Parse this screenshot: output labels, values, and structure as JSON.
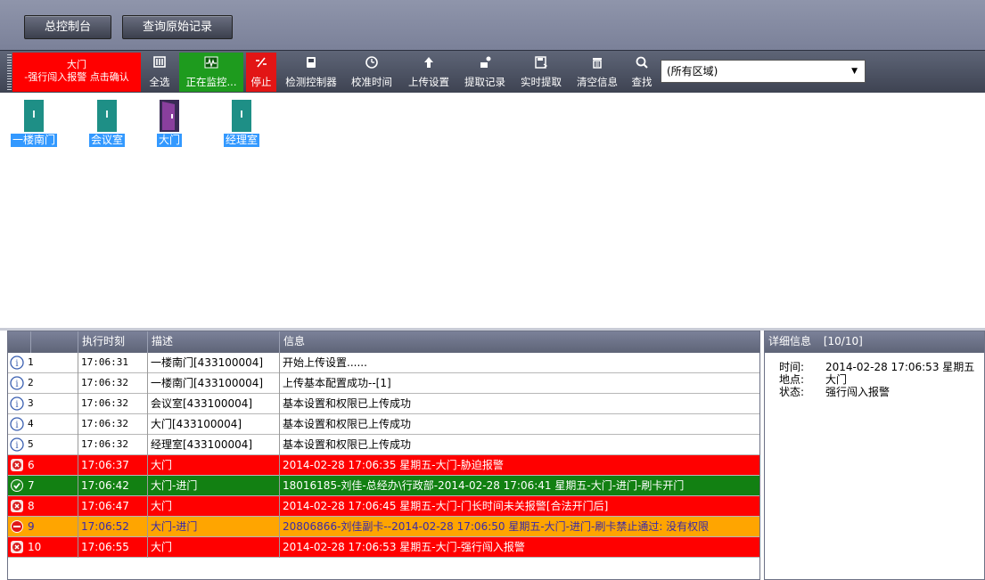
{
  "tabs": [
    "总控制台",
    "查询原始记录"
  ],
  "alarm_banner": {
    "line1": "大门",
    "line2": "-强行闯入报警 点击确认",
    "color": "#ff0000"
  },
  "toolbar": [
    {
      "id": "select-all",
      "icon": "select-all-icon",
      "label": "全选",
      "style": "normal"
    },
    {
      "id": "monitoring",
      "icon": "monitor-wave-icon",
      "label": "正在监控...",
      "style": "green"
    },
    {
      "id": "stop",
      "icon": "stop-icon",
      "label": "停止",
      "style": "red"
    },
    {
      "id": "check-controller",
      "icon": "controller-icon",
      "label": "检测控制器",
      "style": "normal"
    },
    {
      "id": "sync-time",
      "icon": "clock-icon",
      "label": "校准时间",
      "style": "normal"
    },
    {
      "id": "upload-settings",
      "icon": "upload-arrow-icon",
      "label": "上传设置",
      "style": "normal"
    },
    {
      "id": "fetch-records",
      "icon": "fetch-icon",
      "label": "提取记录",
      "style": "normal"
    },
    {
      "id": "realtime-fetch",
      "icon": "realtime-save-icon",
      "label": "实时提取",
      "style": "normal"
    },
    {
      "id": "clear-info",
      "icon": "trash-icon",
      "label": "清空信息",
      "style": "normal"
    },
    {
      "id": "search",
      "icon": "search-icon",
      "label": "查找",
      "style": "normal"
    }
  ],
  "area_select": {
    "value": "(所有区域)"
  },
  "doors": [
    {
      "label": "一楼南门",
      "state": "closed"
    },
    {
      "label": "会议室",
      "state": "closed"
    },
    {
      "label": "大门",
      "state": "open"
    },
    {
      "label": "经理室",
      "state": "closed"
    }
  ],
  "log": {
    "columns": [
      "",
      "执行时刻",
      "描述",
      "信息"
    ],
    "rows": [
      {
        "type": "info",
        "no": "1",
        "time": "17:06:31",
        "desc": "一楼南门[433100004]",
        "msg": "开始上传设置......"
      },
      {
        "type": "info",
        "no": "2",
        "time": "17:06:32",
        "desc": "一楼南门[433100004]",
        "msg": "上传基本配置成功--[1]"
      },
      {
        "type": "info",
        "no": "3",
        "time": "17:06:32",
        "desc": "会议室[433100004]",
        "msg": "基本设置和权限已上传成功"
      },
      {
        "type": "info",
        "no": "4",
        "time": "17:06:32",
        "desc": "大门[433100004]",
        "msg": "基本设置和权限已上传成功"
      },
      {
        "type": "info",
        "no": "5",
        "time": "17:06:32",
        "desc": "经理室[433100004]",
        "msg": "基本设置和权限已上传成功"
      },
      {
        "type": "alarm",
        "no": "6",
        "time": "17:06:37",
        "desc": "大门",
        "msg": "2014-02-28 17:06:35 星期五-大门-胁迫报警"
      },
      {
        "type": "ok",
        "no": "7",
        "time": "17:06:42",
        "desc": "大门-进门",
        "msg": "18016185-刘佳-总经办\\行政部-2014-02-28 17:06:41 星期五-大门-进门-刷卡开门"
      },
      {
        "type": "alarm",
        "no": "8",
        "time": "17:06:47",
        "desc": "大门",
        "msg": "2014-02-28 17:06:45 星期五-大门-门长时间未关报警[合法开门后]"
      },
      {
        "type": "warn",
        "no": "9",
        "time": "17:06:52",
        "desc": "大门-进门",
        "msg": "20806866-刘佳副卡--2014-02-28 17:06:50 星期五-大门-进门-刷卡禁止通过: 没有权限"
      },
      {
        "type": "alarm",
        "no": "10",
        "time": "17:06:55",
        "desc": "大门",
        "msg": "2014-02-28 17:06:53 星期五-大门-强行闯入报警"
      }
    ]
  },
  "detail": {
    "title": "详细信息",
    "count": "[10/10]",
    "time_label": "时间:",
    "time_value": "2014-02-28 17:06:53 星期五",
    "place_label": "地点:",
    "place_value": "大门",
    "status_label": "状态:",
    "status_value": "强行闯入报警"
  }
}
